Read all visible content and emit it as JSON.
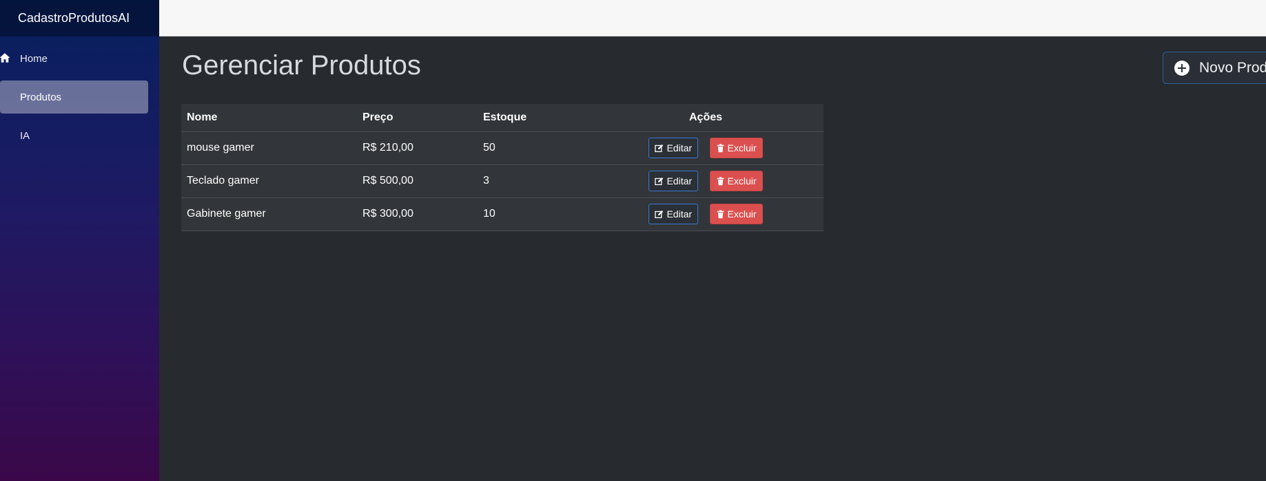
{
  "app": {
    "brand": "CadastroProdutosAI"
  },
  "sidebar": {
    "items": [
      {
        "label": "Home",
        "icon": "home-icon",
        "active": false
      },
      {
        "label": "Produtos",
        "active": true
      },
      {
        "label": "IA",
        "active": false
      }
    ]
  },
  "main": {
    "title": "Gerenciar Produtos",
    "new_button": {
      "label": "Novo Produto",
      "icon": "plus-circle-icon"
    }
  },
  "table": {
    "headers": [
      "Nome",
      "Preço",
      "Estoque",
      "Ações"
    ],
    "rows": [
      {
        "nome": "mouse gamer",
        "preco": "R$ 210,00",
        "estoque": "50",
        "edit_label": "Editar",
        "delete_label": "Excluir"
      },
      {
        "nome": "Teclado gamer",
        "preco": "R$ 500,00",
        "estoque": "3",
        "edit_label": "Editar",
        "delete_label": "Excluir"
      },
      {
        "nome": "Gabinete gamer",
        "preco": "R$ 300,00",
        "estoque": "10",
        "edit_label": "Editar",
        "delete_label": "Excluir"
      }
    ]
  },
  "colors": {
    "background": "#272a2f",
    "table_bg": "#323539",
    "edit_border": "#3a7bd5",
    "delete_bg": "#dc4f4f",
    "sidebar_top": "#06205e",
    "sidebar_bottom": "#3a0849"
  }
}
